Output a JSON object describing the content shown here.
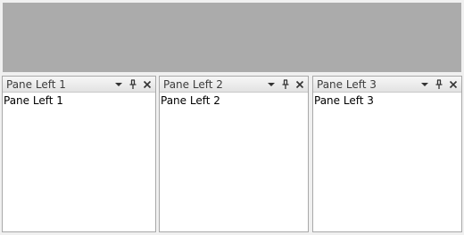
{
  "panes": [
    {
      "title": "Pane Left 1",
      "content": "Pane Left 1"
    },
    {
      "title": "Pane Left 2",
      "content": "Pane Left 2"
    },
    {
      "title": "Pane Left 3",
      "content": "Pane Left 3"
    }
  ],
  "icons": {
    "dropdown": "chevron-down-icon",
    "pin": "pin-icon",
    "close": "close-icon"
  },
  "colors": {
    "top_area": "#ababab",
    "pane_border": "#a9a9a9",
    "header_start": "#f7f7f7",
    "header_end": "#e2e2e2"
  }
}
